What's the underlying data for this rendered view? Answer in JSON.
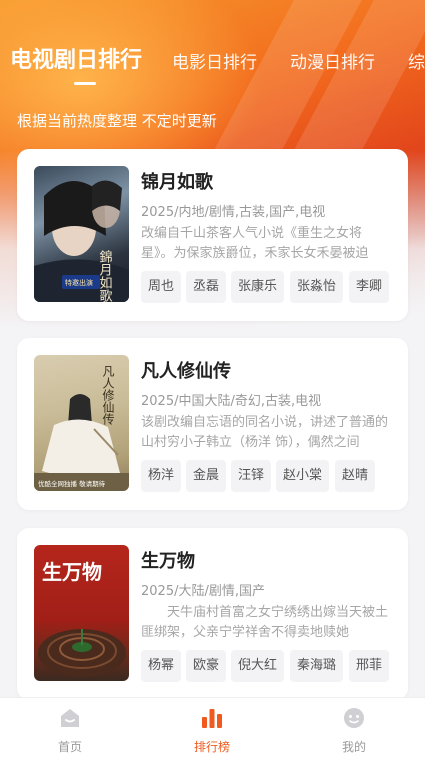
{
  "tabs": [
    {
      "label": "电视剧日排行",
      "active": true
    },
    {
      "label": "电影日排行",
      "active": false
    },
    {
      "label": "动漫日排行",
      "active": false
    },
    {
      "label": "综",
      "active": false
    }
  ],
  "subtitle": "根据当前热度整理 不定时更新",
  "cards": [
    {
      "title": "锦月如歌",
      "meta": "2025/内地/剧情,古装,国产,电视",
      "desc": "改编自千山茶客人气小说《重生之女将星》。为保家族爵位，禾家长女禾晏被迫",
      "cast": [
        "周也",
        "丞磊",
        "张康乐",
        "张淼怡",
        "李卿"
      ],
      "poster_text": "錦月如歌",
      "poster_badge": "特邀出演"
    },
    {
      "title": "凡人修仙传",
      "meta": "2025/中国大陆/奇幻,古装,电视",
      "desc": "该剧改编自忘语的同名小说，讲述了普通的山村穷小子韩立（杨洋 饰），偶然之间",
      "cast": [
        "杨洋",
        "金晨",
        "汪铎",
        "赵小棠",
        "赵晴"
      ],
      "poster_text": "凡人修仙传",
      "poster_badge": "优酷全网独播 敬请期待"
    },
    {
      "title": "生万物",
      "meta": "2025/大陆/剧情,国产",
      "desc": "　　天牛庙村首富之女宁绣绣出嫁当天被土匪绑架，父亲宁学祥舍不得卖地赎她",
      "cast": [
        "杨幂",
        "欧豪",
        "倪大红",
        "秦海璐",
        "邢菲"
      ],
      "poster_text": "生万物",
      "poster_badge": ""
    }
  ],
  "nav": [
    {
      "label": "首页",
      "icon": "home-icon",
      "active": false
    },
    {
      "label": "排行榜",
      "icon": "ranking-icon",
      "active": true
    },
    {
      "label": "我的",
      "icon": "profile-icon",
      "active": false
    }
  ],
  "colors": {
    "accent": "#f05a1e",
    "header_orange": "#f26a1d",
    "header_red": "#e2461c"
  }
}
